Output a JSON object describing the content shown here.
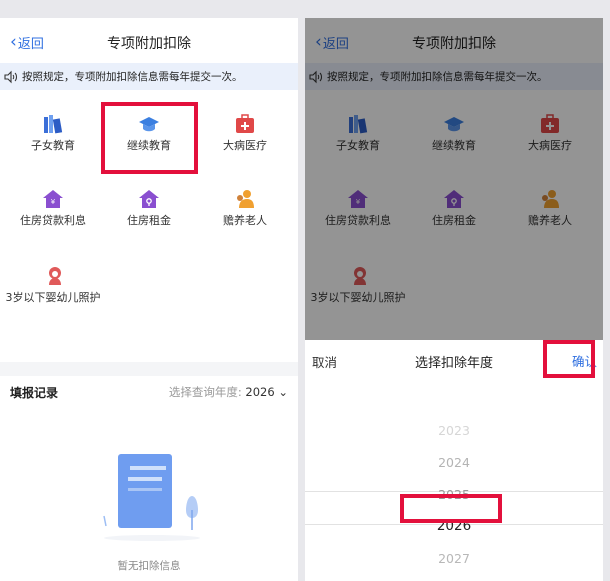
{
  "screen": {
    "nav": {
      "back_label": "返回",
      "title": "专项附加扣除"
    },
    "notice": "按照规定，专项附加扣除信息需每年提交一次。",
    "items": [
      {
        "label": "子女教育",
        "icon": "books-icon",
        "color": "#3b6fd8"
      },
      {
        "label": "继续教育",
        "icon": "graduation-cap-icon",
        "color": "#3b7fe0"
      },
      {
        "label": "大病医疗",
        "icon": "medical-kit-icon",
        "color": "#e04848"
      },
      {
        "label": "住房贷款利息",
        "icon": "house-loan-icon",
        "color": "#8a4fd0"
      },
      {
        "label": "住房租金",
        "icon": "house-rent-icon",
        "color": "#8a4fd0"
      },
      {
        "label": "赡养老人",
        "icon": "elderly-icon",
        "color": "#f0a030"
      },
      {
        "label": "3岁以下婴幼儿照护",
        "icon": "infant-icon",
        "color": "#e05a5a"
      }
    ],
    "records": {
      "title": "填报记录",
      "query_label": "选择查询年度:",
      "year": "2026"
    },
    "empty_text": "暂无扣除信息"
  },
  "sheet": {
    "cancel": "取消",
    "title": "选择扣除年度",
    "confirm": "确认",
    "years": [
      "2023",
      "2024",
      "2025",
      "2026",
      "2027"
    ],
    "selected": "2026"
  },
  "colors": {
    "accent": "#2f6fe0",
    "highlight": "#e3103c",
    "notice_bg": "#eaf0fb"
  }
}
